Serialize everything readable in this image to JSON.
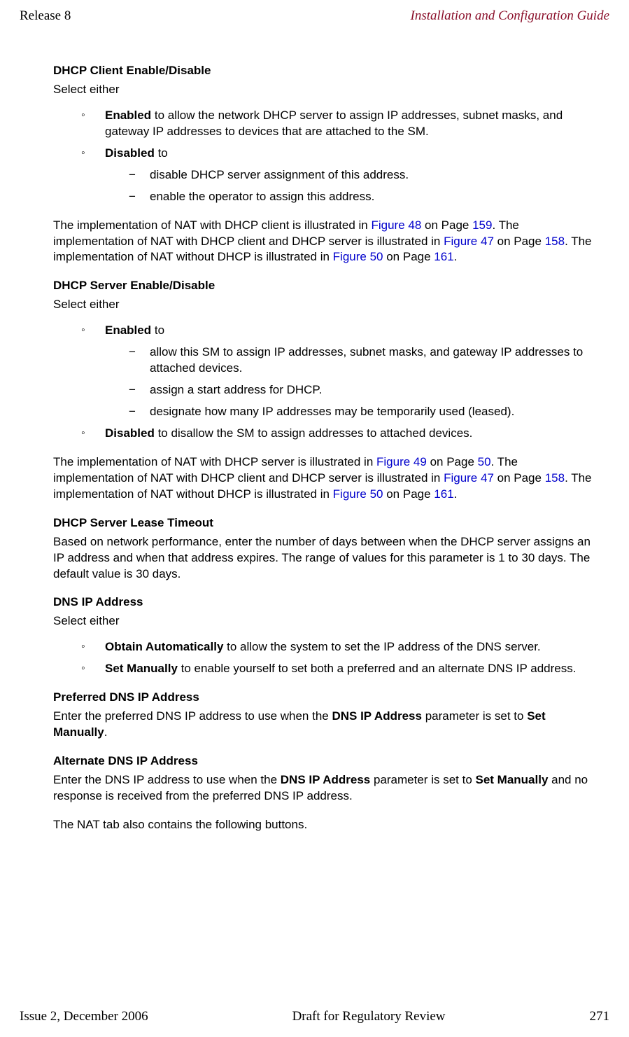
{
  "header": {
    "left": "Release 8",
    "right": "Installation and Configuration Guide"
  },
  "footer": {
    "left": "Issue 2, December 2006",
    "center": "Draft for Regulatory Review",
    "right": "271"
  },
  "sec1": {
    "title": "DHCP Client Enable/Disable",
    "lead": "Select either",
    "item1_b": "Enabled",
    "item1_rest": " to allow the network DHCP server to assign IP addresses, subnet masks, and gateway IP addresses to devices that are attached to the SM.",
    "item2_b": "Disabled",
    "item2_rest": " to",
    "item2_sub1": "disable DHCP server assignment of this address.",
    "item2_sub2": "enable the operator to assign this address.",
    "para_t1": "The implementation of NAT with DHCP client is illustrated in ",
    "para_l1": "Figure 48",
    "para_t2": " on Page ",
    "para_l2": "159",
    "para_t3": ". The implementation of NAT with DHCP client and DHCP server is illustrated in ",
    "para_l3": "Figure 47",
    "para_t4": " on Page ",
    "para_l4": "158",
    "para_t5": ". The implementation of NAT without DHCP is illustrated in ",
    "para_l5": "Figure 50",
    "para_t6": " on Page ",
    "para_l6": "161",
    "para_t7": "."
  },
  "sec2": {
    "title": "DHCP Server Enable/Disable",
    "lead": "Select either",
    "item1_b": "Enabled",
    "item1_rest": " to",
    "item1_sub1": "allow this SM to assign IP addresses, subnet masks, and gateway IP addresses to attached devices.",
    "item1_sub2": "assign a start address for DHCP.",
    "item1_sub3": "designate how many IP addresses may be temporarily used (leased).",
    "item2_b": "Disabled",
    "item2_rest": " to disallow the SM to assign addresses to attached devices.",
    "para_t1": "The implementation of NAT with DHCP server is illustrated in ",
    "para_l1": "Figure 49",
    "para_t2": " on Page ",
    "para_l2": "50",
    "para_t3": ". The implementation of NAT with DHCP client and DHCP server is illustrated in ",
    "para_l3": "Figure 47",
    "para_t4": " on Page ",
    "para_l4": "158",
    "para_t5": ". The implementation of NAT without DHCP is illustrated in ",
    "para_l5": "Figure 50",
    "para_t6": " on Page ",
    "para_l6": "161",
    "para_t7": "."
  },
  "sec3": {
    "title": "DHCP Server Lease Timeout",
    "body": "Based on network performance, enter the number of days between when the DHCP server assigns an IP address and when that address expires. The range of values for this parameter is 1 to 30 days. The default value is 30 days."
  },
  "sec4": {
    "title": "DNS IP Address",
    "lead": "Select either",
    "item1_b": "Obtain Automatically",
    "item1_rest": " to allow the system to set the IP address of the DNS server.",
    "item2_b": "Set Manually",
    "item2_rest": " to enable yourself to set both a preferred and an alternate DNS IP address."
  },
  "sec5": {
    "title": "Preferred DNS IP Address",
    "t1": "Enter the preferred DNS IP address to use when the ",
    "b1": "DNS IP Address",
    "t2": " parameter is set to ",
    "b2": "Set Manually",
    "t3": "."
  },
  "sec6": {
    "title": "Alternate DNS IP Address",
    "t1": "Enter the DNS IP address to use when the ",
    "b1": "DNS IP Address",
    "t2": " parameter is set to ",
    "b2": "Set Manually",
    "t3": " and no response is received from the preferred DNS IP address.",
    "tail": "The NAT tab also contains the following buttons."
  }
}
